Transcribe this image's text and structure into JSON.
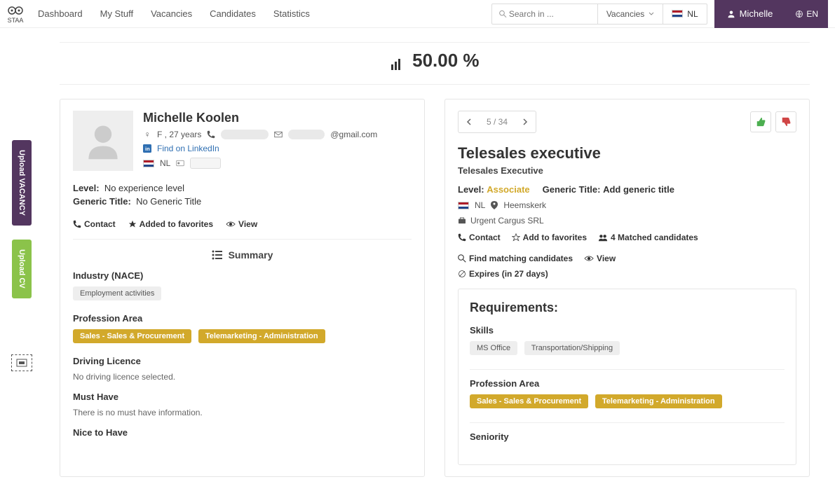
{
  "logo_text": "STAA",
  "nav": [
    "Dashboard",
    "My Stuff",
    "Vacancies",
    "Candidates",
    "Statistics"
  ],
  "search": {
    "placeholder": "Search in ...",
    "select": "Vacancies",
    "country": "NL"
  },
  "user": {
    "name": "Michelle",
    "lang": "EN"
  },
  "left_rail": {
    "upload_vacancy": "Upload VACANCY",
    "upload_cv": "Upload CV"
  },
  "match_percent": "50.00 %",
  "candidate": {
    "name": "Michelle Koolen",
    "gender_age": "F , 27 years",
    "email_suffix": "@gmail.com",
    "linkedin": "Find on LinkedIn",
    "country": "NL",
    "level_label": "Level:",
    "level_value": "No experience level",
    "generic_label": "Generic Title:",
    "generic_value": "No Generic Title",
    "actions": {
      "contact": "Contact",
      "fav": "Added to favorites",
      "view": "View"
    },
    "summary_label": "Summary",
    "industry_label": "Industry (NACE)",
    "industry_tags": [
      "Employment activities"
    ],
    "profession_label": "Profession Area",
    "profession_tags": [
      "Sales - Sales & Procurement",
      "Telemarketing - Administration"
    ],
    "driving_label": "Driving Licence",
    "driving_value": "No driving licence selected.",
    "musthave_label": "Must Have",
    "musthave_value": "There is no must have information.",
    "nicetohave_label": "Nice to Have"
  },
  "vacancy": {
    "pager": "5 / 34",
    "title": "Telesales executive",
    "subtitle": "Telesales Executive",
    "level_label": "Level:",
    "level_value": "Associate",
    "generic_label": "Generic Title:",
    "generic_value": "Add generic title",
    "country": "NL",
    "city": "Heemskerk",
    "company": "Urgent Cargus SRL",
    "actions": {
      "contact": "Contact",
      "fav": "Add to favorites",
      "matched": "4 Matched candidates",
      "find": "Find matching candidates",
      "view": "View"
    },
    "expires": "Expires (in 27 days)",
    "req_head": "Requirements:",
    "skills_label": "Skills",
    "skills": [
      "MS Office",
      "Transportation/Shipping"
    ],
    "profession_label": "Profession Area",
    "profession_tags": [
      "Sales - Sales & Procurement",
      "Telemarketing - Administration"
    ],
    "seniority_label": "Seniority"
  }
}
